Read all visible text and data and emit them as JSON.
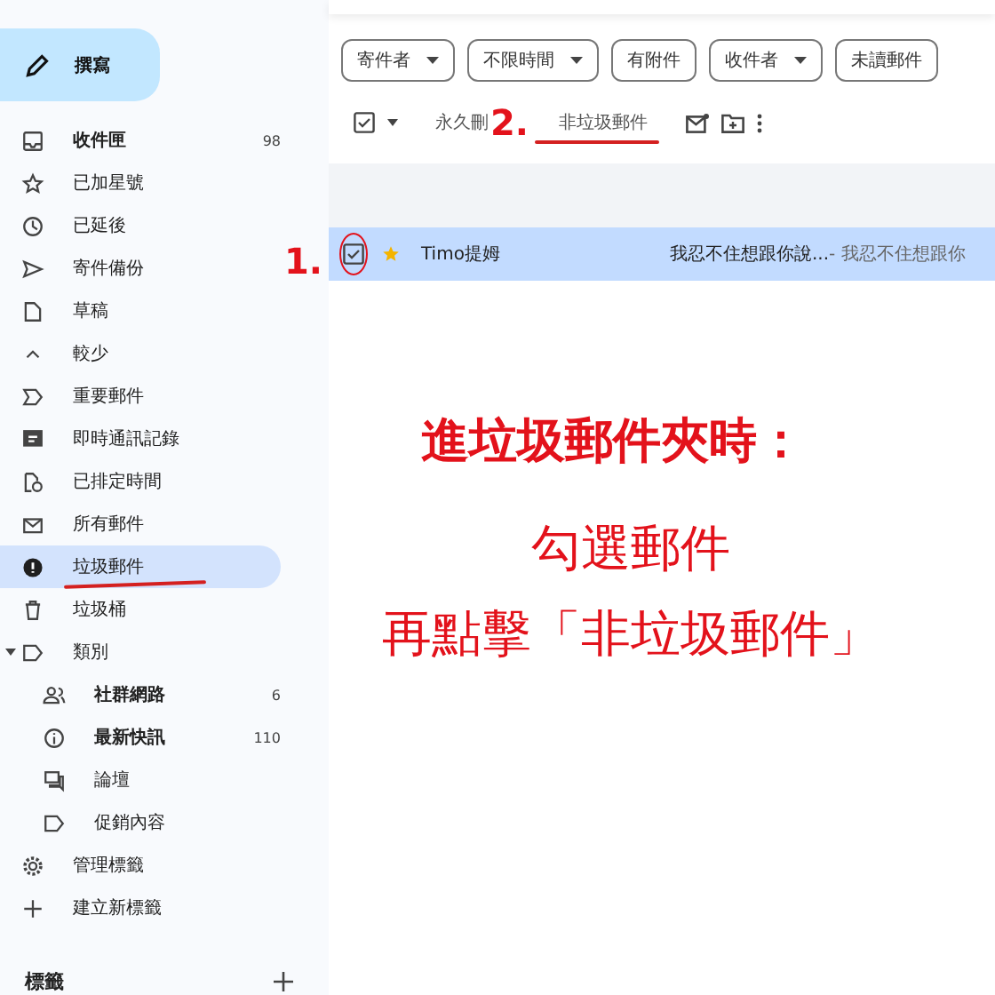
{
  "compose": {
    "label": "撰寫"
  },
  "sidebar": {
    "items": [
      {
        "label": "收件匣",
        "count": "98",
        "unread": true,
        "selected": false
      },
      {
        "label": "已加星號",
        "unread": false,
        "selected": false
      },
      {
        "label": "已延後",
        "unread": false,
        "selected": false
      },
      {
        "label": "寄件備份",
        "unread": false,
        "selected": false
      },
      {
        "label": "草稿",
        "unread": false,
        "selected": false
      },
      {
        "label": "較少",
        "unread": false,
        "selected": false
      },
      {
        "label": "重要郵件",
        "unread": false,
        "selected": false
      },
      {
        "label": "即時通訊記錄",
        "unread": false,
        "selected": false
      },
      {
        "label": "已排定時間",
        "unread": false,
        "selected": false
      },
      {
        "label": "所有郵件",
        "unread": false,
        "selected": false
      },
      {
        "label": "垃圾郵件",
        "unread": false,
        "selected": true
      },
      {
        "label": "垃圾桶",
        "unread": false,
        "selected": false
      },
      {
        "label": "類別",
        "unread": false,
        "selected": false,
        "expanded": true,
        "children": [
          {
            "label": "社群網路",
            "count": "6",
            "unread": true,
            "selected": false
          },
          {
            "label": "最新快訊",
            "count": "110",
            "unread": true,
            "selected": false
          },
          {
            "label": "論壇",
            "unread": false,
            "selected": false
          },
          {
            "label": "促銷內容",
            "unread": false,
            "selected": false
          }
        ]
      },
      {
        "label": "管理標籤",
        "unread": false,
        "selected": false
      },
      {
        "label": "建立新標籤",
        "unread": false,
        "selected": false
      }
    ],
    "labels_header": "標籤"
  },
  "filters": [
    {
      "label": "寄件者",
      "dropdown": true
    },
    {
      "label": "不限時間",
      "dropdown": true
    },
    {
      "label": "有附件",
      "dropdown": false
    },
    {
      "label": "收件者",
      "dropdown": true
    },
    {
      "label": "未讀郵件",
      "dropdown": false
    }
  ],
  "toolbar": {
    "select_all_checked": true,
    "delete_label": "永久刪",
    "not_spam_label": "非垃圾郵件"
  },
  "messages": [
    {
      "sender": "Timo提姆",
      "subject": "我忍不住想跟你說...",
      "snippet": " - 我忍不住想跟你",
      "checked": true,
      "starred": true,
      "selected": true
    }
  ],
  "annotations": {
    "step_1": "1.",
    "step_2": "2.",
    "heading": "進垃圾郵件夾時：",
    "line_1": "勾選郵件",
    "line_2": "再點擊「非垃圾郵件」"
  }
}
